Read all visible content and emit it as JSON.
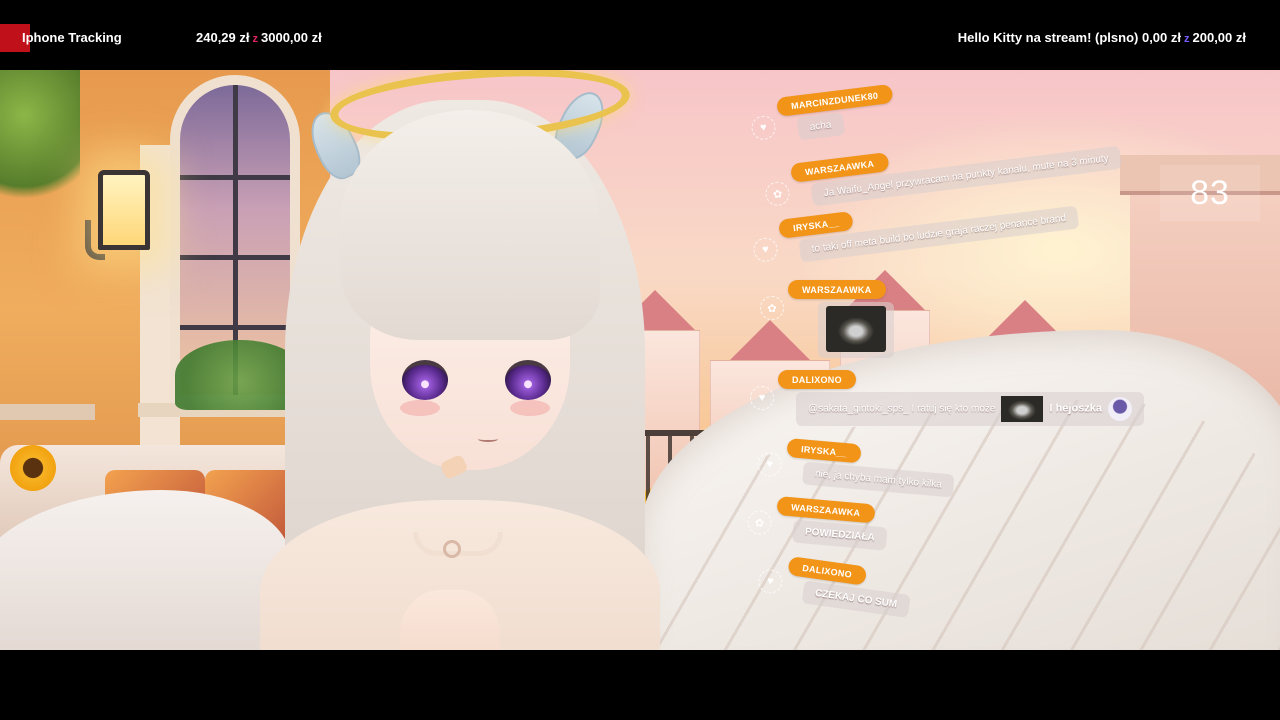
{
  "topbar": {
    "left_goal": {
      "title": "Iphone Tracking",
      "current": "240,29 zł",
      "separator": "z",
      "target": "3000,00 zł",
      "progress_color": "#c0111a",
      "progress_fraction": 0.08
    },
    "right_goal": {
      "title": "Hello Kitty na stream! (plsno)",
      "current": "0,00 zł",
      "separator": "z",
      "target": "200,00 zł"
    }
  },
  "counter": {
    "value": "83"
  },
  "chat": {
    "accent_color": "#f29418",
    "messages": [
      {
        "user": "MARCINZDUNEK80",
        "badge": "heart-icon",
        "text": "acha"
      },
      {
        "user": "WARSZAAWKA",
        "badge": "flower-icon",
        "text": "Ja Waifu_Angel przywracam na punkty kanału, mute na 3 minuty"
      },
      {
        "user": "IRYSKA__",
        "badge": "heart-icon",
        "text": "to taki off meta build bo ludzie graja raczej penance brand"
      },
      {
        "user": "WARSZAAWKA",
        "badge": "flower-icon",
        "emote": "cat-emote"
      },
      {
        "user": "DALIXONO",
        "badge": "heart-icon",
        "text": "@sakata_gintoki_sps_ I ratuj się kto może",
        "text_after": "I hejoszka"
      },
      {
        "user": "IRYSKA__",
        "badge": "heart-icon",
        "text": "nie, ja chyba mam tylko kilka"
      },
      {
        "user": "WARSZAAWKA",
        "badge": "flower-icon",
        "text": "POWIEDZIAŁA"
      },
      {
        "user": "DALIXONO",
        "badge": "heart-icon",
        "text": "CZEKAJ CO SUM"
      }
    ]
  }
}
